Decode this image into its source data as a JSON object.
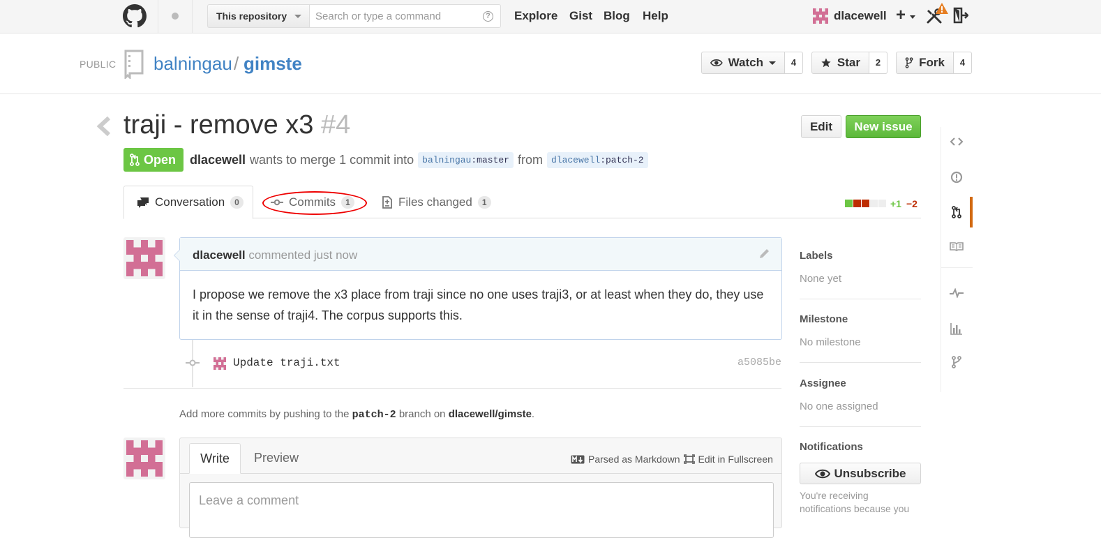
{
  "header": {
    "scope_label": "This repository",
    "search_placeholder": "Search or type a command",
    "search_help": "?",
    "nav": [
      "Explore",
      "Gist",
      "Blog",
      "Help"
    ],
    "username": "dlacewell",
    "new_menu": "+"
  },
  "repo": {
    "visibility": "PUBLIC",
    "owner": "balningau",
    "separator": "/",
    "name": "gimste",
    "watch_label": "Watch",
    "watch_count": "4",
    "star_label": "Star",
    "star_count": "2",
    "fork_label": "Fork",
    "fork_count": "4"
  },
  "issue": {
    "title": "traji - remove x3",
    "number": "#4",
    "edit_label": "Edit",
    "new_issue_label": "New issue",
    "state": "Open",
    "author": "dlacewell",
    "merge_text": "wants to merge 1 commit into",
    "base_user": "balningau",
    "base_branch": ":master",
    "from_text": "from",
    "head_user": "dlacewell",
    "head_branch": ":patch-2"
  },
  "tabs": [
    {
      "label": "Conversation",
      "count": "0"
    },
    {
      "label": "Commits",
      "count": "1"
    },
    {
      "label": "Files changed",
      "count": "1"
    }
  ],
  "diffstat": {
    "additions": "+1",
    "deletions": "−2",
    "blocks": [
      "#6cc644",
      "#bd2c00",
      "#bd2c00",
      "#eeeeee",
      "#eeeeee"
    ]
  },
  "comment": {
    "author": "dlacewell",
    "meta": "commented just now",
    "body": "I propose we remove the x3 place from traji since no one uses traji3, or at least when they do, they use it in the sense of traji4. The corpus supports this."
  },
  "commit": {
    "message": "Update traji.txt",
    "sha": "a5085be"
  },
  "push_hint": {
    "prefix": "Add more commits by pushing to the",
    "branch": "patch-2",
    "middle": "branch on",
    "repo": "dlacewell/gimste",
    "suffix": "."
  },
  "form": {
    "write_tab": "Write",
    "preview_tab": "Preview",
    "markdown_note": "Parsed as Markdown",
    "fullscreen_note": "Edit in Fullscreen",
    "placeholder": "Leave a comment"
  },
  "sidebar": {
    "labels_title": "Labels",
    "labels_value": "None yet",
    "milestone_title": "Milestone",
    "milestone_value": "No milestone",
    "assignee_title": "Assignee",
    "assignee_value": "No one assigned",
    "notifications_title": "Notifications",
    "unsubscribe_label": "Unsubscribe",
    "notifications_text": "You're receiving notifications because you"
  },
  "colors": {
    "link": "#4183c4",
    "open_green": "#6cc644",
    "active_orange": "#d26911",
    "avatar_pink": "#d26f95"
  }
}
